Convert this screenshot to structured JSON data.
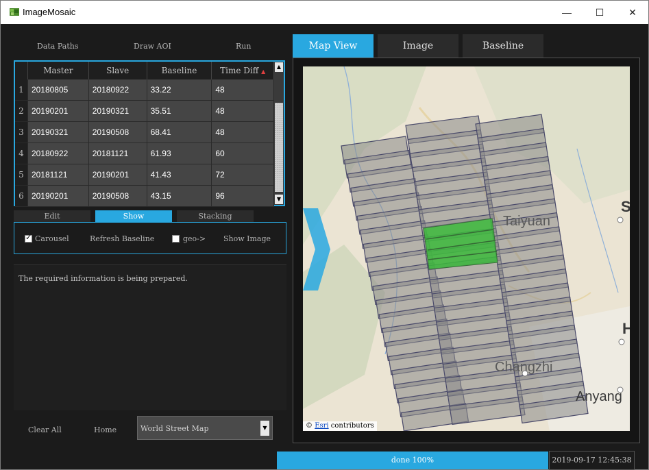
{
  "app": {
    "title": "ImageMosaic"
  },
  "window_controls": {
    "minimize": "—",
    "maximize": "☐",
    "close": "✕"
  },
  "menu": {
    "data_paths": "Data Paths",
    "draw_aoi": "Draw AOI",
    "run": "Run"
  },
  "table": {
    "headers": {
      "master": "Master",
      "slave": "Slave",
      "baseline": "Baseline",
      "time_diff": "Time Diff"
    },
    "rows": [
      {
        "idx": "1",
        "master": "20180805",
        "slave": "20180922",
        "baseline": "33.22",
        "time_diff": "48"
      },
      {
        "idx": "2",
        "master": "20190201",
        "slave": "20190321",
        "baseline": "35.51",
        "time_diff": "48"
      },
      {
        "idx": "3",
        "master": "20190321",
        "slave": "20190508",
        "baseline": "68.41",
        "time_diff": "48"
      },
      {
        "idx": "4",
        "master": "20180922",
        "slave": "20181121",
        "baseline": "61.93",
        "time_diff": "60"
      },
      {
        "idx": "5",
        "master": "20181121",
        "slave": "20190201",
        "baseline": "41.43",
        "time_diff": "72"
      },
      {
        "idx": "6",
        "master": "20190201",
        "slave": "20190508",
        "baseline": "43.15",
        "time_diff": "96"
      }
    ]
  },
  "subtabs": {
    "edit": "Edit",
    "show": "Show",
    "stacking": "Stacking",
    "active": "Show"
  },
  "show_panel": {
    "carousel": "Carousel",
    "carousel_checked": true,
    "refresh_baseline": "Refresh Baseline",
    "geo": "geo->",
    "geo_checked": false,
    "show_image": "Show Image"
  },
  "log": {
    "message": "The required information is being prepared."
  },
  "bottom": {
    "clear_all": "Clear All",
    "home": "Home",
    "basemap": "World Street Map"
  },
  "right_tabs": {
    "map_view": "Map View",
    "image": "Image",
    "baseline": "Baseline",
    "active": "Map View"
  },
  "map": {
    "labels": {
      "taiyuan": "Taiyuan",
      "changzhi": "Changzhi",
      "anyang": "Anyang",
      "s": "S",
      "h": "H"
    },
    "attribution": {
      "prefix": "©",
      "esri": "Esri",
      "rest": " contributors"
    },
    "footprint_color": "#888888",
    "aoi_color": "#3cb83c"
  },
  "status": {
    "progress_text": "done 100%",
    "progress": 1.0,
    "timestamp": "2019-09-17 12:45:38"
  },
  "colors": {
    "accent": "#29a8e0",
    "background": "#1b1b1b"
  }
}
